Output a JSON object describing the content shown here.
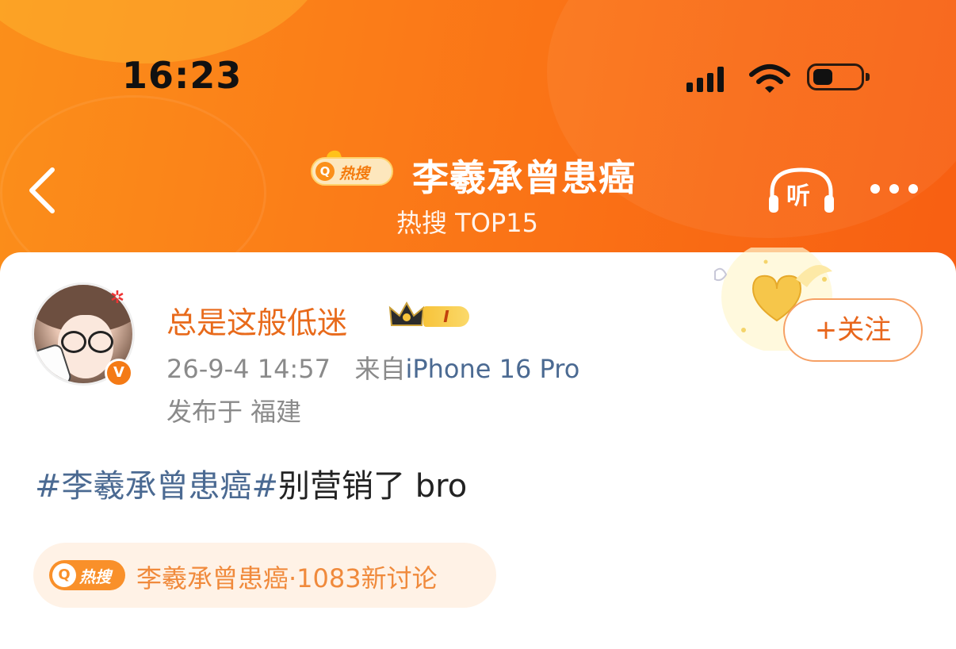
{
  "status_bar": {
    "time": "16:23"
  },
  "nav": {
    "hot_badge_label": "热搜",
    "title": "李羲承曾患癌",
    "subtitle": "热搜 TOP15",
    "listen_label": "听"
  },
  "user": {
    "name": "总是这般低迷",
    "level": "I",
    "verified_mark": "V",
    "time": "26-9-4 14:57",
    "source_prefix": "来自",
    "device": "iPhone 16 Pro",
    "location": "发布于 福建"
  },
  "follow_button": {
    "label": "+关注"
  },
  "post": {
    "hashtag": "#李羲承曾患癌#",
    "text": "别营销了 bro"
  },
  "hot_topic": {
    "badge_label": "热搜",
    "text": "李羲承曾患癌·1083新讨论"
  },
  "colors": {
    "accent": "#fb7b18",
    "link": "#4b6a92",
    "username": "#e86a1b"
  }
}
